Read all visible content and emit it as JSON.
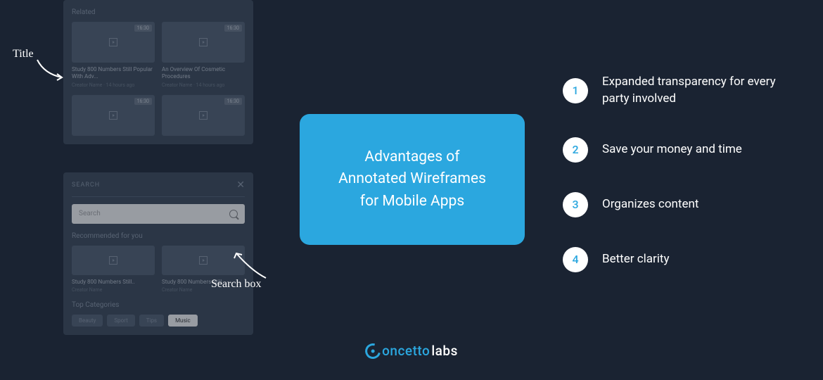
{
  "annotations": {
    "title": "Title",
    "search": "Search box"
  },
  "wireframe1": {
    "header": "Related",
    "cards": [
      {
        "badge": "16:30",
        "title": "Study 800 Numbers Still Popular With Adv...",
        "meta": "Creator Name · 14 hours ago"
      },
      {
        "badge": "16:30",
        "title": "An Overview Of Cosmetic Procedures",
        "meta": "Creator Name · 14 hours ago"
      },
      {
        "badge": "16:30",
        "title": "",
        "meta": ""
      },
      {
        "badge": "16:30",
        "title": "",
        "meta": ""
      }
    ]
  },
  "wireframe2": {
    "header": "SEARCH",
    "close": "✕",
    "placeholder": "Search",
    "recommended": "Recommended for you",
    "cards": [
      {
        "title": "Study 800 Numbers Still..",
        "meta": "Creator Name"
      },
      {
        "title": "Study 800 Numbers Still..",
        "meta": "Creator Name"
      }
    ],
    "topcat": "Top Categories",
    "tags": [
      {
        "label": "Beauty",
        "active": false
      },
      {
        "label": "Sport",
        "active": false
      },
      {
        "label": "Tips",
        "active": false
      },
      {
        "label": "Music",
        "active": true
      }
    ]
  },
  "center": {
    "line1": "Advantages of",
    "line2": "Annotated Wireframes",
    "line3": "for Mobile Apps"
  },
  "list": [
    {
      "num": "1",
      "text": "Expanded transparency for every party involved"
    },
    {
      "num": "2",
      "text": "Save your money and time"
    },
    {
      "num": "3",
      "text": "Organizes content"
    },
    {
      "num": "4",
      "text": "Better clarity"
    }
  ],
  "logo": {
    "part1": "oncetto",
    "part2": "labs"
  }
}
